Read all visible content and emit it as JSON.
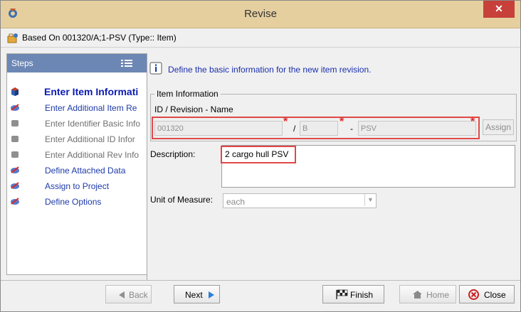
{
  "window": {
    "title": "Revise",
    "close_label": "✕"
  },
  "based_on": "Based On 001320/A;1-PSV (Type:: Item)",
  "steps": {
    "header": "Steps",
    "items": [
      {
        "label": "Enter Item Informati",
        "state": "active"
      },
      {
        "label": "Enter Additional Item Re",
        "state": "blue"
      },
      {
        "label": "Enter Identifier Basic Info",
        "state": "gray"
      },
      {
        "label": "Enter Additional ID Infor",
        "state": "gray"
      },
      {
        "label": "Enter Additional Rev Info",
        "state": "gray"
      },
      {
        "label": "Define Attached Data",
        "state": "blue"
      },
      {
        "label": "Assign to Project",
        "state": "blue"
      },
      {
        "label": "Define Options",
        "state": "blue"
      }
    ]
  },
  "info_text": "Define the basic information for the new item revision.",
  "item_info": {
    "legend": "Item Information",
    "id_rev_label": "ID / Revision - Name",
    "id_value": "001320",
    "rev_value": "B",
    "name_value": "PSV",
    "separator_slash": "/",
    "separator_dash": "-",
    "required_marker": "*",
    "assign_label": "Assign"
  },
  "description": {
    "label": "Description:",
    "value": "2 cargo hull PSV"
  },
  "uom": {
    "label": "Unit of Measure:",
    "value": "each"
  },
  "buttons": {
    "back": "Back",
    "next": "Next",
    "finish": "Finish",
    "home": "Home",
    "close": "Close"
  },
  "colors": {
    "title_bar": "#e6cf9f",
    "steps_header": "#6d87b5",
    "highlight": "#e04848",
    "active_step": "#0b1ab0"
  }
}
